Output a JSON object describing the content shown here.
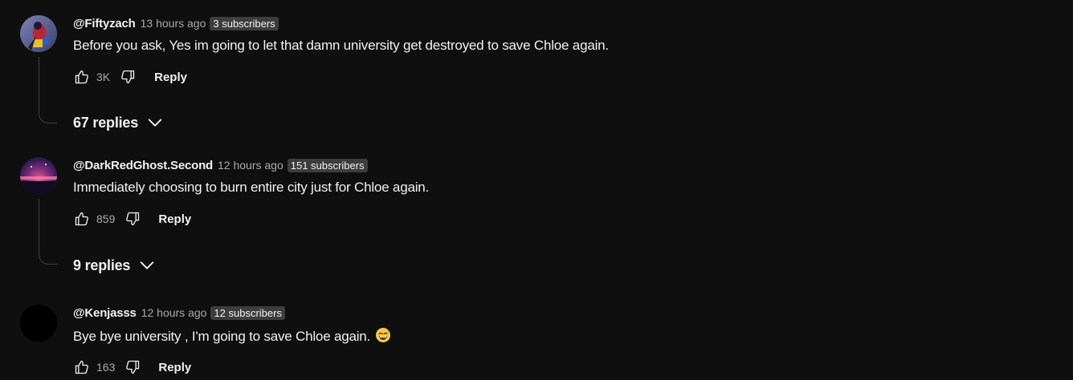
{
  "comments": [
    {
      "author": "@Fiftyzach",
      "time": "13 hours ago",
      "badge": "3 subscribers",
      "text": "Before you ask, Yes im going to let that damn university get destroyed to save Chloe again.",
      "likes": "3K",
      "reply_label": "Reply",
      "replies_label": "67 replies",
      "avatar_colors": [
        "#6a6f9a",
        "#c0392b",
        "#2c2f5a"
      ]
    },
    {
      "author": "@DarkRedGhost.Second",
      "time": "12 hours ago",
      "badge": "151 subscribers",
      "text": "Immediately choosing to burn entire city just for Chloe again.",
      "likes": "859",
      "reply_label": "Reply",
      "replies_label": "9 replies",
      "avatar_colors": [
        "#3b2a6e",
        "#e0457a",
        "#1a1030"
      ]
    },
    {
      "author": "@Kenjasss",
      "time": "12 hours ago",
      "badge": "12 subscribers",
      "text": "Bye bye university , I'm going to save Chloe again.",
      "likes": "163",
      "reply_label": "Reply",
      "avatar_colors": [
        "#000000"
      ]
    }
  ],
  "icons": {
    "like": "thumbs-up-icon",
    "dislike": "thumbs-down-icon",
    "expand": "chevron-down-icon",
    "emoji": "grinning-sweat-emoji-icon"
  },
  "colors": {
    "background": "#0f0f0f",
    "text": "#f1f1f1",
    "secondary_text": "#aaaaaa",
    "badge_bg": "#3d3d3d",
    "thread_line": "#3f3f3f"
  }
}
